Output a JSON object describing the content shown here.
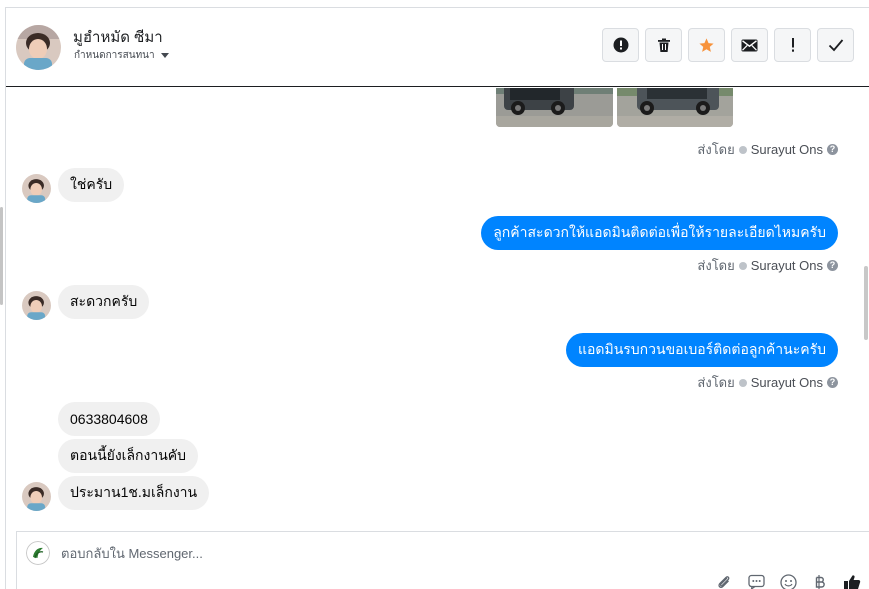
{
  "header": {
    "contact_name": "มูฮำหมัด ซีมา",
    "assign_label": "กำหนดการสนทนา",
    "actions": [
      {
        "icon": "alert-circle-icon",
        "name": "mark-spam-button"
      },
      {
        "icon": "trash-icon",
        "name": "delete-button"
      },
      {
        "icon": "star-icon",
        "name": "star-button"
      },
      {
        "icon": "envelope-icon",
        "name": "mark-unread-button"
      },
      {
        "icon": "exclamation-icon",
        "name": "follow-up-button"
      },
      {
        "icon": "checkmark-icon",
        "name": "mark-done-button"
      }
    ]
  },
  "thread": {
    "sent_by_prefix": "ส่งโดย",
    "sent_by_name": "Surayut Ons",
    "messages": {
      "m1": "ใช่ครับ",
      "m2": "ลูกค้าสะดวกให้แอดมินติดต่อเพื่อให้รายละเอียดไหมครับ",
      "m3": "สะดวกครับ",
      "m4": "แอดมินรบกวนขอเบอร์ติดต่อลูกค้านะครับ",
      "m5": "0633804608",
      "m6": "ตอนนี้ยังเล็กงานคับ",
      "m7": "ประมาน1ช.มเล็กงาน"
    }
  },
  "composer": {
    "placeholder": "ตอบกลับใน Messenger...",
    "tools": [
      "paperclip-icon",
      "saved-reply-icon",
      "emoji-icon",
      "baht-icon",
      "thumbs-up-icon"
    ]
  },
  "colors": {
    "outgoing_bubble": "#0084ff",
    "incoming_bubble": "#f0f0f0",
    "star": "#f7923b"
  }
}
